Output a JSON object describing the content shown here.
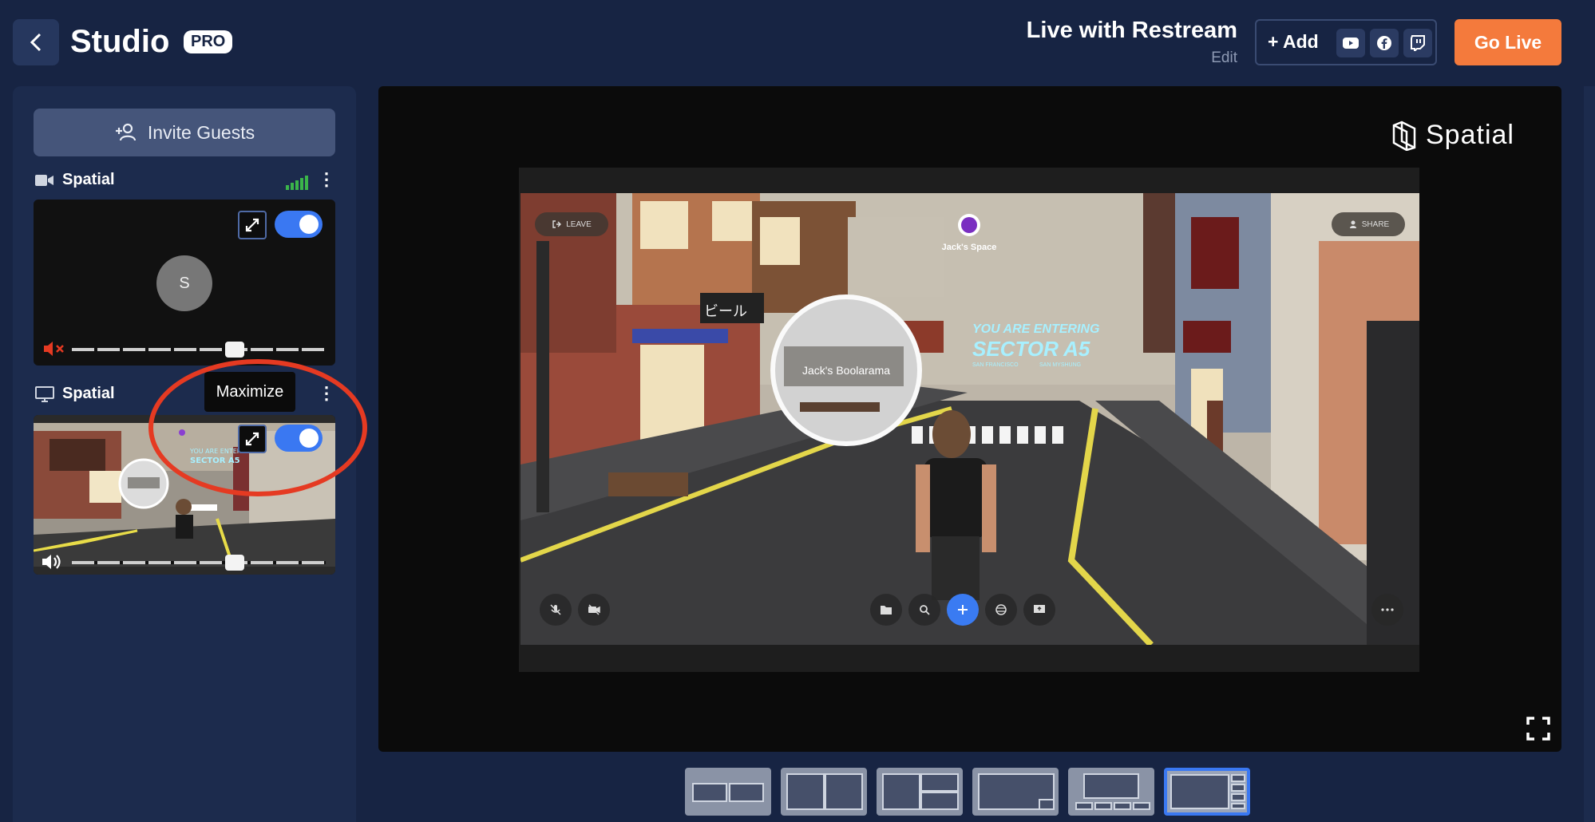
{
  "header": {
    "studio_title": "Studio",
    "badge": "PRO",
    "broadcast_title": "Live with Restream",
    "edit_label": "Edit",
    "add_label": "+ Add",
    "destinations": [
      "youtube-icon",
      "facebook-icon",
      "twitch-icon"
    ],
    "go_live_label": "Go Live"
  },
  "sidebar": {
    "invite_label": "Invite Guests",
    "sources": [
      {
        "label": "Spatial",
        "type": "camera",
        "avatar_initial": "S",
        "enabled": true,
        "muted": true
      },
      {
        "label": "Spatial",
        "type": "screen",
        "enabled": true,
        "muted": false
      }
    ],
    "tooltip": "Maximize"
  },
  "stage": {
    "watermark": "Spatial",
    "scene": {
      "leave_label": "LEAVE",
      "share_label": "SHARE",
      "space_name": "Jack's Space",
      "portal_label": "Jack's Boolarama",
      "banner_line1": "YOU ARE ENTERING",
      "banner_line2": "SECTOR A5",
      "banner_cities_left": "SAN FRANCISCO",
      "banner_cities_right": "SAN MYSHUNG",
      "shop_sign": "ビール"
    }
  },
  "layouts": {
    "count": 6,
    "selected_index": 5
  },
  "colors": {
    "background": "#172443",
    "panel": "#1c2b4d",
    "accent": "#3a78f2",
    "go_live": "#f47a3c",
    "annotation": "#e53a22"
  }
}
